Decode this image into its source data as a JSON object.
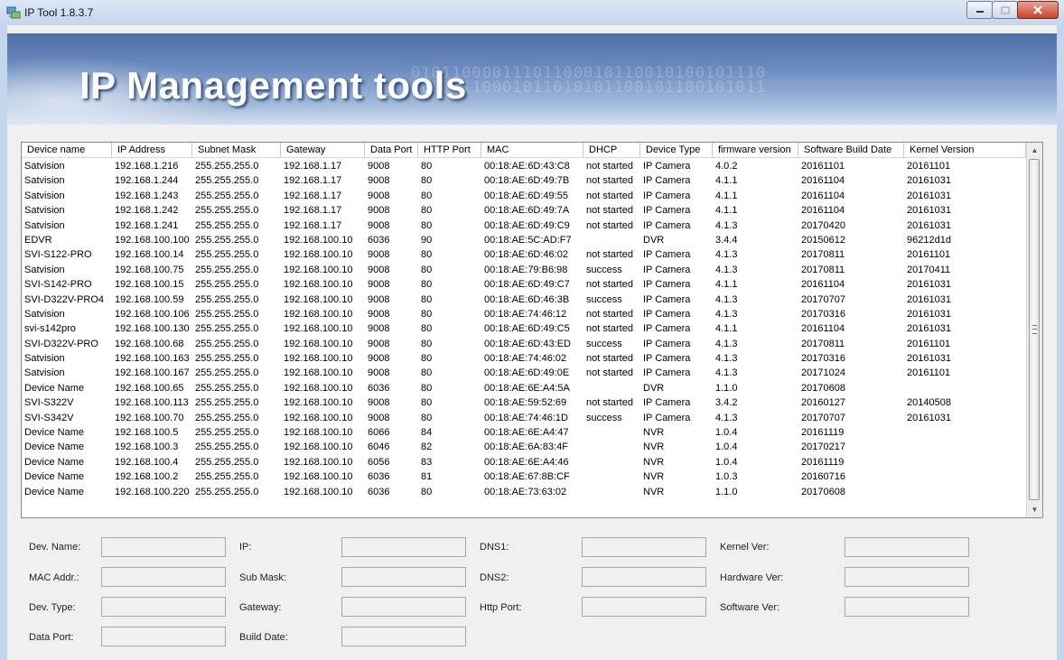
{
  "window": {
    "title": "IP Tool 1.8.3.7"
  },
  "banner": {
    "title": "IP Management tools",
    "binary_bg": [
      "01011000011101100010110010100101110",
      "10010110001011010101100101100101011"
    ]
  },
  "table": {
    "columns": [
      "Device name",
      "IP Address",
      "Subnet Mask",
      "Gateway",
      "Data Port",
      "HTTP Port",
      "MAC",
      "DHCP",
      "Device Type",
      "firmware version",
      "Software Build Date",
      "Kernel Version"
    ],
    "rows": [
      [
        "Satvision",
        "192.168.1.216",
        "255.255.255.0",
        "192.168.1.17",
        "9008",
        "80",
        "00:18:AE:6D:43:C8",
        "not started",
        "IP Camera",
        "4.0.2",
        "20161101",
        "20161101"
      ],
      [
        "Satvision",
        "192.168.1.244",
        "255.255.255.0",
        "192.168.1.17",
        "9008",
        "80",
        "00:18:AE:6D:49:7B",
        "not started",
        "IP Camera",
        "4.1.1",
        "20161104",
        "20161031"
      ],
      [
        "Satvision",
        "192.168.1.243",
        "255.255.255.0",
        "192.168.1.17",
        "9008",
        "80",
        "00:18:AE:6D:49:55",
        "not started",
        "IP Camera",
        "4.1.1",
        "20161104",
        "20161031"
      ],
      [
        "Satvision",
        "192.168.1.242",
        "255.255.255.0",
        "192.168.1.17",
        "9008",
        "80",
        "00:18:AE:6D:49:7A",
        "not started",
        "IP Camera",
        "4.1.1",
        "20161104",
        "20161031"
      ],
      [
        "Satvision",
        "192.168.1.241",
        "255.255.255.0",
        "192.168.1.17",
        "9008",
        "80",
        "00:18:AE:6D:49:C9",
        "not started",
        "IP Camera",
        "4.1.3",
        "20170420",
        "20161031"
      ],
      [
        "EDVR",
        "192.168.100.100",
        "255.255.255.0",
        "192.168.100.10",
        "6036",
        "90",
        "00:18:AE:5C:AD:F7",
        "",
        "DVR",
        "3.4.4",
        "20150612",
        "96212d1d"
      ],
      [
        "SVI-S122-PRO",
        "192.168.100.14",
        "255.255.255.0",
        "192.168.100.10",
        "9008",
        "80",
        "00:18:AE:6D:46:02",
        "not started",
        "IP Camera",
        "4.1.3",
        "20170811",
        "20161101"
      ],
      [
        "Satvision",
        "192.168.100.75",
        "255.255.255.0",
        "192.168.100.10",
        "9008",
        "80",
        "00:18:AE:79:B6:98",
        "success",
        "IP Camera",
        "4.1.3",
        "20170811",
        "20170411"
      ],
      [
        "SVI-S142-PRO",
        "192.168.100.15",
        "255.255.255.0",
        "192.168.100.10",
        "9008",
        "80",
        "00:18:AE:6D:49:C7",
        "not started",
        "IP Camera",
        "4.1.1",
        "20161104",
        "20161031"
      ],
      [
        "SVI-D322V-PRO4",
        "192.168.100.59",
        "255.255.255.0",
        "192.168.100.10",
        "9008",
        "80",
        "00:18:AE:6D:46:3B",
        "success",
        "IP Camera",
        "4.1.3",
        "20170707",
        "20161031"
      ],
      [
        "Satvision",
        "192.168.100.106",
        "255.255.255.0",
        "192.168.100.10",
        "9008",
        "80",
        "00:18:AE:74:46:12",
        "not started",
        "IP Camera",
        "4.1.3",
        "20170316",
        "20161031"
      ],
      [
        "svi-s142pro",
        "192.168.100.130",
        "255.255.255.0",
        "192.168.100.10",
        "9008",
        "80",
        "00:18:AE:6D:49:C5",
        "not started",
        "IP Camera",
        "4.1.1",
        "20161104",
        "20161031"
      ],
      [
        "SVI-D322V-PRO",
        "192.168.100.68",
        "255.255.255.0",
        "192.168.100.10",
        "9008",
        "80",
        "00:18:AE:6D:43:ED",
        "success",
        "IP Camera",
        "4.1.3",
        "20170811",
        "20161101"
      ],
      [
        "Satvision",
        "192.168.100.163",
        "255.255.255.0",
        "192.168.100.10",
        "9008",
        "80",
        "00:18:AE:74:46:02",
        "not started",
        "IP Camera",
        "4.1.3",
        "20170316",
        "20161031"
      ],
      [
        "Satvision",
        "192.168.100.167",
        "255.255.255.0",
        "192.168.100.10",
        "9008",
        "80",
        "00:18:AE:6D:49:0E",
        "not started",
        "IP Camera",
        "4.1.3",
        "20171024",
        "20161101"
      ],
      [
        "Device Name",
        "192.168.100.65",
        "255.255.255.0",
        "192.168.100.10",
        "6036",
        "80",
        "00:18:AE:6E:A4:5A",
        "",
        "DVR",
        "1.1.0",
        "20170608",
        ""
      ],
      [
        "SVI-S322V",
        "192.168.100.113",
        "255.255.255.0",
        "192.168.100.10",
        "9008",
        "80",
        "00:18:AE:59:52:69",
        "not started",
        "IP Camera",
        "3.4.2",
        "20160127",
        "20140508"
      ],
      [
        "SVI-S342V",
        "192.168.100.70",
        "255.255.255.0",
        "192.168.100.10",
        "9008",
        "80",
        "00:18:AE:74:46:1D",
        "success",
        "IP Camera",
        "4.1.3",
        "20170707",
        "20161031"
      ],
      [
        "Device Name",
        "192.168.100.5",
        "255.255.255.0",
        "192.168.100.10",
        "6066",
        "84",
        "00:18:AE:6E:A4:47",
        "",
        "NVR",
        "1.0.4",
        "20161119",
        ""
      ],
      [
        "Device Name",
        "192.168.100.3",
        "255.255.255.0",
        "192.168.100.10",
        "6046",
        "82",
        "00:18:AE:6A:83:4F",
        "",
        "NVR",
        "1.0.4",
        "20170217",
        ""
      ],
      [
        "Device Name",
        "192.168.100.4",
        "255.255.255.0",
        "192.168.100.10",
        "6056",
        "83",
        "00:18:AE:6E:A4:46",
        "",
        "NVR",
        "1.0.4",
        "20161119",
        ""
      ],
      [
        "Device Name",
        "192.168.100.2",
        "255.255.255.0",
        "192.168.100.10",
        "6036",
        "81",
        "00:18:AE:67:8B:CF",
        "",
        "NVR",
        "1.0.3",
        "20160716",
        ""
      ],
      [
        "Device Name",
        "192.168.100.220",
        "255.255.255.0",
        "192.168.100.10",
        "6036",
        "80",
        "00:18:AE:73:63:02",
        "",
        "NVR",
        "1.1.0",
        "20170608",
        ""
      ]
    ]
  },
  "details": {
    "dev_name": {
      "label": "Dev. Name:",
      "value": ""
    },
    "mac_addr": {
      "label": "MAC Addr.:",
      "value": ""
    },
    "dev_type": {
      "label": "Dev. Type:",
      "value": ""
    },
    "data_port": {
      "label": "Data Port:",
      "value": ""
    },
    "ip": {
      "label": "IP:",
      "value": ""
    },
    "sub_mask": {
      "label": "Sub Mask:",
      "value": ""
    },
    "gateway": {
      "label": "Gateway:",
      "value": ""
    },
    "build_date": {
      "label": "Build Date:",
      "value": ""
    },
    "dns1": {
      "label": "DNS1:",
      "value": ""
    },
    "dns2": {
      "label": "DNS2:",
      "value": ""
    },
    "http_port": {
      "label": "Http Port:",
      "value": ""
    },
    "kernel_ver": {
      "label": "Kernel Ver:",
      "value": ""
    },
    "hardware_ver": {
      "label": "Hardware Ver:",
      "value": ""
    },
    "software_ver": {
      "label": "Software Ver:",
      "value": ""
    }
  },
  "colors": {
    "accent": "#4e6fa7",
    "close": "#c4412b"
  }
}
